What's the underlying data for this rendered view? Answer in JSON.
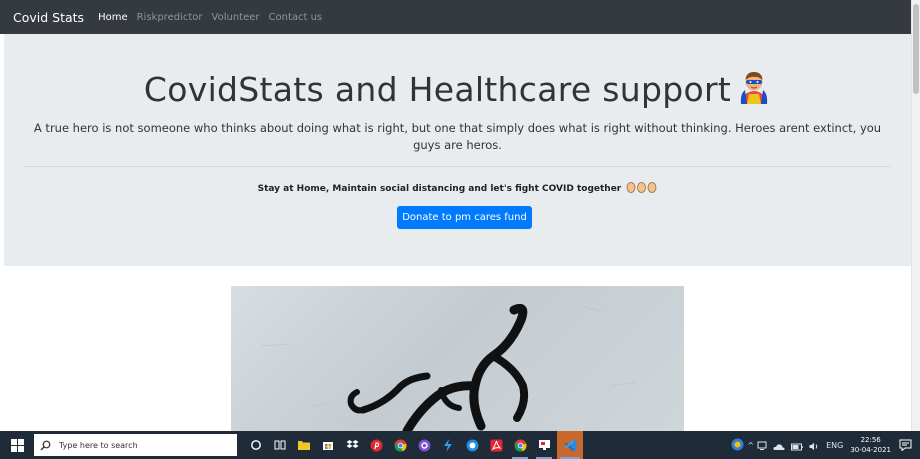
{
  "navbar": {
    "brand": "Covid Stats",
    "links": [
      {
        "label": "Home",
        "active": true
      },
      {
        "label": "Riskpredictor",
        "active": false
      },
      {
        "label": "Volunteer",
        "active": false
      },
      {
        "label": "Contact us",
        "active": false
      }
    ]
  },
  "hero": {
    "title": "CovidStats and Healthcare support",
    "title_icon": "superhero-emoji-icon",
    "text": "A true hero is not someone who thinks about doing what is right, but one that simply does what is right without thinking. Heroes arent extinct, you guys are heros.",
    "tagline": "Stay at Home, Maintain social distancing and let's fight COVID together",
    "tagline_icon": "clapping-hands-icon",
    "donate_label": "Donate to pm cares fund"
  },
  "colors": {
    "navbar": "#343a40",
    "jumbotron": "#e9ecef",
    "primary": "#007bff",
    "taskbar": "#1f2b38"
  },
  "taskbar": {
    "search_placeholder": "Type here to search",
    "tray_language": "ENG",
    "time": "22:56",
    "date": "30-04-2021"
  }
}
